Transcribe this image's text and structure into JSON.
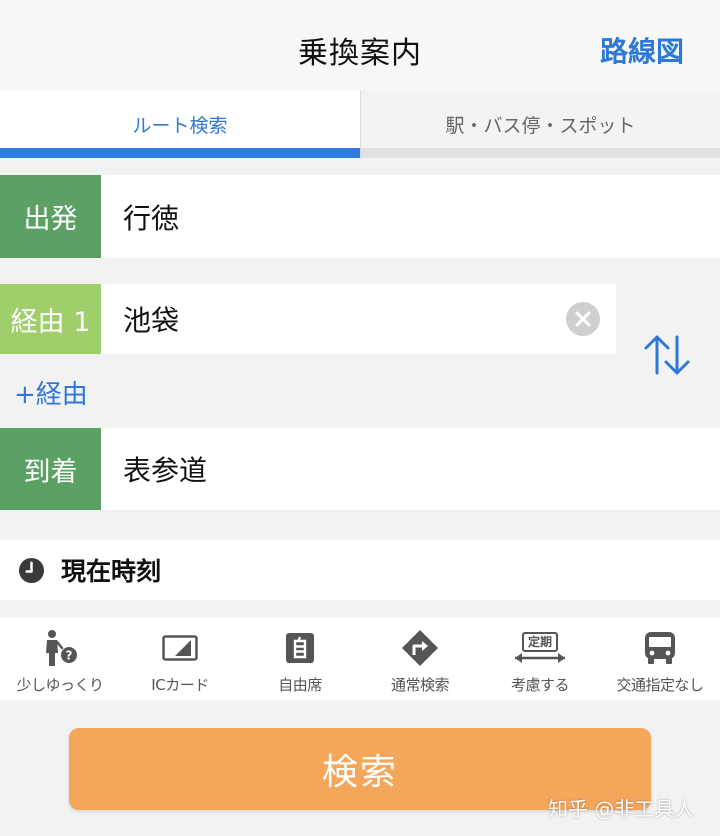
{
  "header": {
    "title": "乗換案内",
    "map_label": "路線図"
  },
  "tabs": [
    {
      "label": "ルート検索",
      "active": true
    },
    {
      "label": "駅・バス停・スポット",
      "active": false
    }
  ],
  "route": {
    "departure": {
      "label": "出発",
      "value": "行徳"
    },
    "via": {
      "label": "経由 1",
      "value": "池袋"
    },
    "add_via": "+経由",
    "arrival": {
      "label": "到着",
      "value": "表参道"
    }
  },
  "time": {
    "label": "現在時刻"
  },
  "options": [
    {
      "label": "少しゆっくり",
      "icon": "walking-person-icon"
    },
    {
      "label": "ICカード",
      "icon": "ic-card-icon"
    },
    {
      "label": "自由席",
      "icon": "free-seat-icon"
    },
    {
      "label": "通常検索",
      "icon": "turn-right-sign-icon"
    },
    {
      "label": "考慮する",
      "icon": "commuter-pass-icon",
      "badge": "定期"
    },
    {
      "label": "交通指定なし",
      "icon": "bus-icon"
    }
  ],
  "search_label": "検索",
  "watermark": "知乎 @非工具人",
  "colors": {
    "accent_blue": "#2f78d6",
    "label_green": "#5aa163",
    "label_light_green": "#9fce6b",
    "search_orange": "#f4a65b"
  }
}
